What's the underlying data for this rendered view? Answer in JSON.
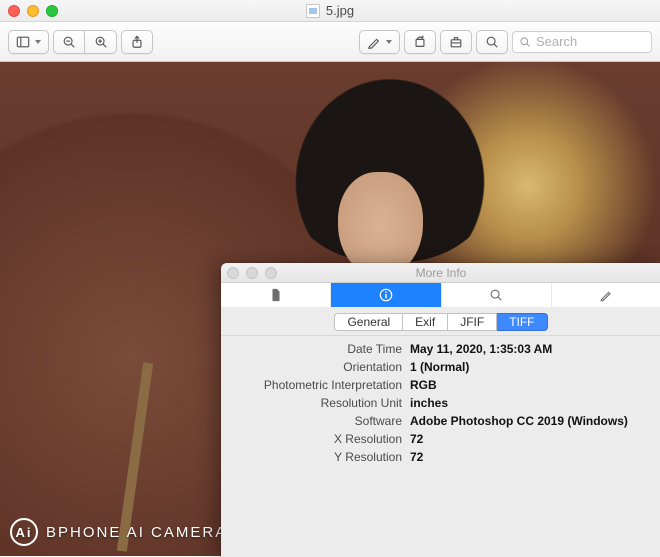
{
  "window": {
    "title": "5.jpg",
    "search_placeholder": "Search"
  },
  "toolbar": {
    "buttons": {
      "sidebar": "sidebar-button",
      "zoom_out": "zoom-out-button",
      "zoom_in": "zoom-in-button",
      "share": "share-button",
      "markup": "markup-button",
      "rotate": "rotate-button",
      "toolbox": "toolbox-button"
    }
  },
  "watermark": {
    "badge": "Ai",
    "text": "BPHONE AI CAMERA"
  },
  "info_panel": {
    "title": "More Info",
    "primary_tabs": [
      {
        "id": "document",
        "icon": "document-icon"
      },
      {
        "id": "info",
        "icon": "info-icon",
        "active": true
      },
      {
        "id": "search",
        "icon": "search-icon"
      },
      {
        "id": "annotate",
        "icon": "pencil-icon"
      }
    ],
    "secondary_tabs": [
      {
        "id": "general",
        "label": "General"
      },
      {
        "id": "exif",
        "label": "Exif"
      },
      {
        "id": "jfif",
        "label": "JFIF"
      },
      {
        "id": "tiff",
        "label": "TIFF",
        "active": true
      }
    ],
    "fields": [
      {
        "key": "Date Time",
        "value": "May 11, 2020, 1:35:03 AM"
      },
      {
        "key": "Orientation",
        "value": "1 (Normal)"
      },
      {
        "key": "Photometric Interpretation",
        "value": "RGB"
      },
      {
        "key": "Resolution Unit",
        "value": "inches"
      },
      {
        "key": "Software",
        "value": "Adobe Photoshop CC 2019 (Windows)"
      },
      {
        "key": "X Resolution",
        "value": "72"
      },
      {
        "key": "Y Resolution",
        "value": "72"
      }
    ]
  }
}
